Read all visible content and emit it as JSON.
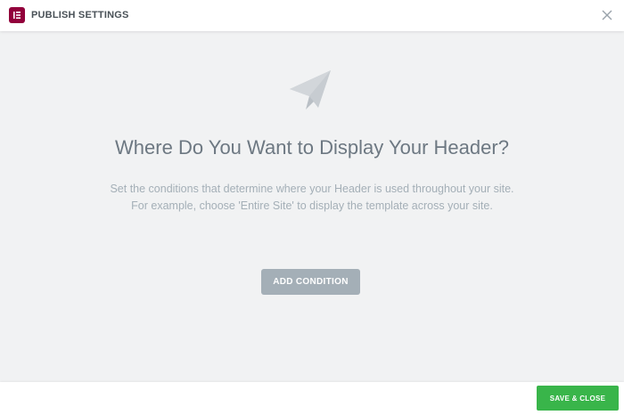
{
  "header": {
    "title": "PUBLISH SETTINGS",
    "logo_icon": "elementor-logo-icon",
    "close_icon": "close-icon"
  },
  "content": {
    "icon": "paper-plane-icon",
    "title": "Where Do You Want to Display Your Header?",
    "description_line1": "Set the conditions that determine where your Header is used throughout your site.",
    "description_line2": "For example, choose 'Entire Site' to display the template across your site.",
    "add_condition_label": "ADD CONDITION"
  },
  "footer": {
    "save_close_label": "SAVE & CLOSE"
  },
  "colors": {
    "brand": "#92003b",
    "save": "#39b54a",
    "add_button": "#a4afb7",
    "title_text": "#6d7882",
    "desc_text": "#a4afb7"
  }
}
